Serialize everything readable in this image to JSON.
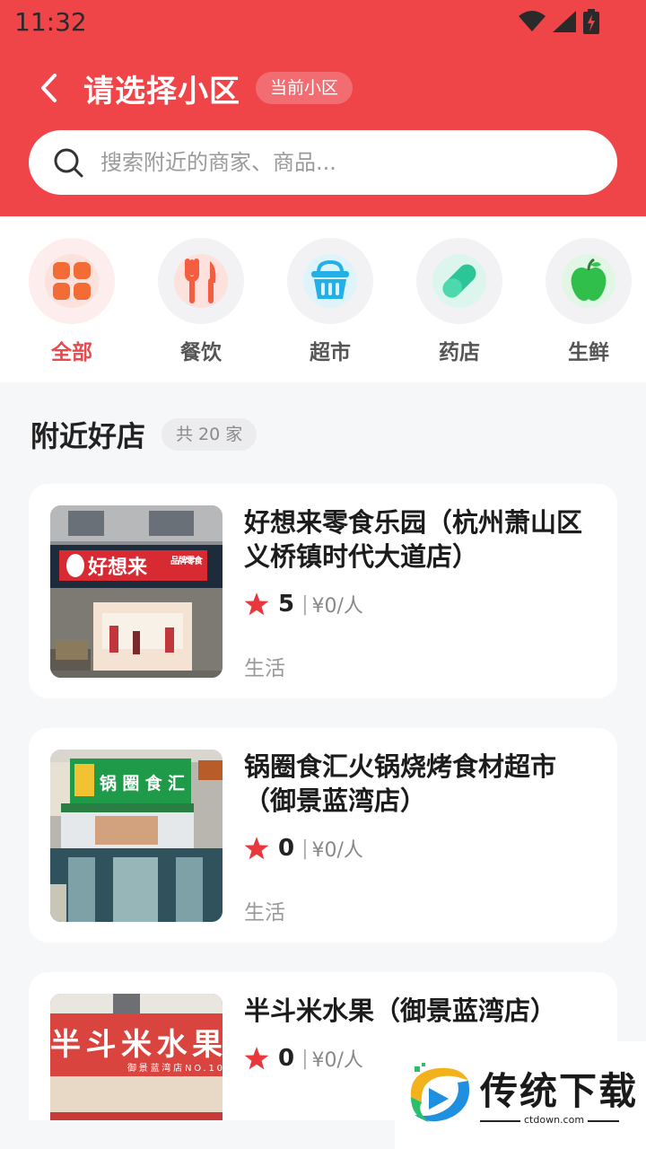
{
  "status": {
    "time": "11:32"
  },
  "header": {
    "title": "请选择小区",
    "current_badge": "当前小区",
    "search_placeholder": "搜索附近的商家、商品..."
  },
  "categories": [
    {
      "label": "全部",
      "icon": "grid-icon",
      "active": true
    },
    {
      "label": "餐饮",
      "icon": "fork-knife-icon",
      "active": false
    },
    {
      "label": "超市",
      "icon": "basket-icon",
      "active": false
    },
    {
      "label": "药店",
      "icon": "pill-icon",
      "active": false
    },
    {
      "label": "生鲜",
      "icon": "apple-icon",
      "active": false
    }
  ],
  "section": {
    "title": "附近好店",
    "count": "共 20 家"
  },
  "shops": [
    {
      "name": "好想来零食乐园（杭州萧山区义桥镇时代大道店）",
      "rating": "5",
      "price": "¥0/人",
      "tag": "生活",
      "sign": "好想来",
      "sign_sub": "品牌零食"
    },
    {
      "name": "锅圈食汇火锅烧烤食材超市（御景蓝湾店）",
      "rating": "0",
      "price": "¥0/人",
      "tag": "生活",
      "sign": "锅圈食汇"
    },
    {
      "name": "半斗米水果（御景蓝湾店）",
      "rating": "0",
      "price": "¥0/人",
      "tag": "",
      "sign": "半斗米水果",
      "sign_sub": "御景蓝湾店NO.10"
    }
  ],
  "separator": "|",
  "watermark": {
    "text": "传统下载",
    "url": "ctdown.com"
  },
  "colors": {
    "brand_red": "#ef4549",
    "active_text": "#e84a4d",
    "star": "#e8383d"
  }
}
